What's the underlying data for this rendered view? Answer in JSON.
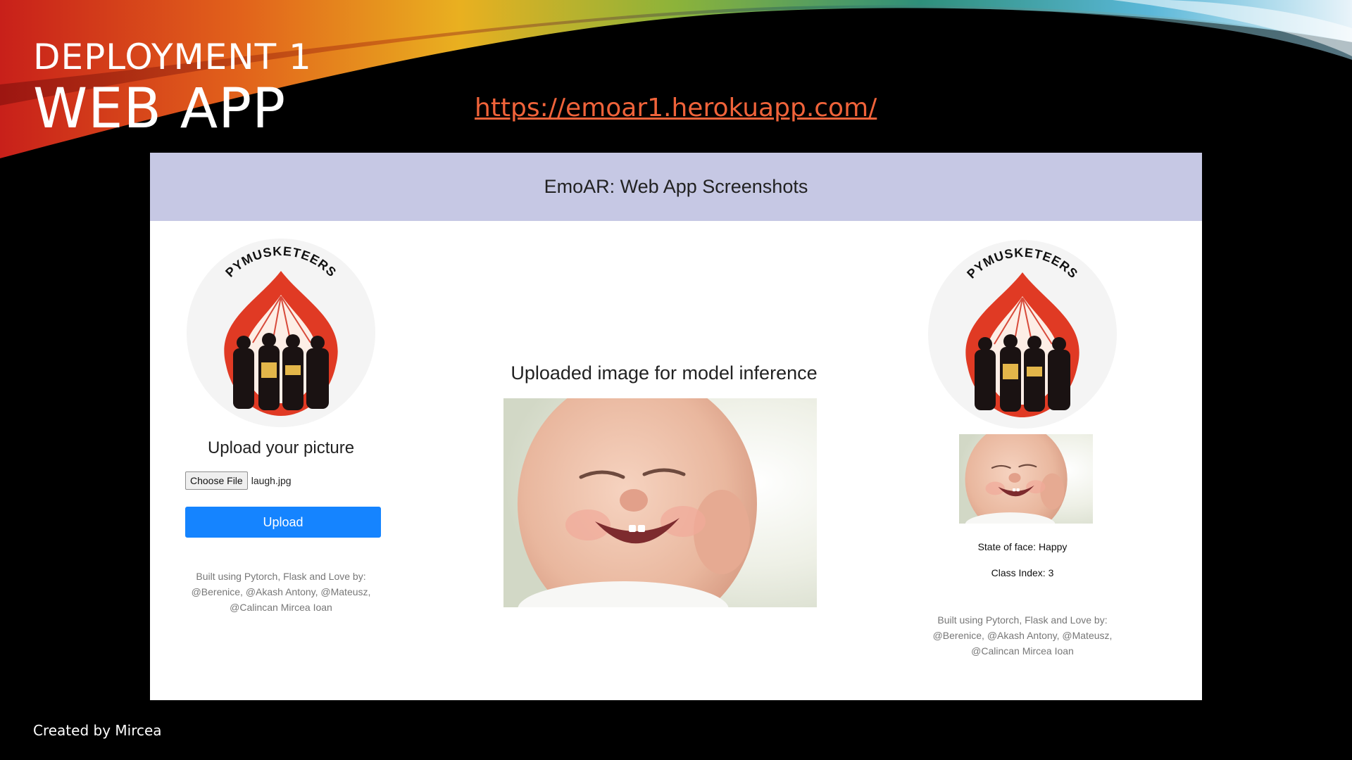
{
  "slide": {
    "title_line1": "DEPLOYMENT 1",
    "title_line2": "WEB APP",
    "url": "https://emoar1.herokuapp.com/",
    "created_by": "Created by Mircea"
  },
  "app": {
    "header": "EmoAR: Web App Screenshots",
    "logo_text": "PYMUSKETEERS",
    "left_panel": {
      "upload_title": "Upload your picture",
      "choose_file_label": "Choose File",
      "file_name": "laugh.jpg",
      "upload_button": "Upload",
      "footer_line1": "Built using Pytorch, Flask and Love by:",
      "footer_line2": "@Berenice, @Akash Antony, @Mateusz,",
      "footer_line3": "@Calincan Mircea Ioan"
    },
    "center_panel": {
      "title": "Uploaded image for model inference"
    },
    "right_panel": {
      "state_of_face": "State of face: Happy",
      "class_index": "Class Index: 3",
      "footer_line1": "Built using Pytorch, Flask and Love by:",
      "footer_line2": "@Berenice, @Akash Antony, @Mateusz,",
      "footer_line3": "@Calincan Mircea Ioan"
    }
  },
  "colors": {
    "header_bg": "#c6c8e4",
    "upload_button": "#1584ff",
    "link": "#f0633a"
  },
  "icons": [
    "pymusketeers-logo-icon",
    "baby-photo"
  ]
}
